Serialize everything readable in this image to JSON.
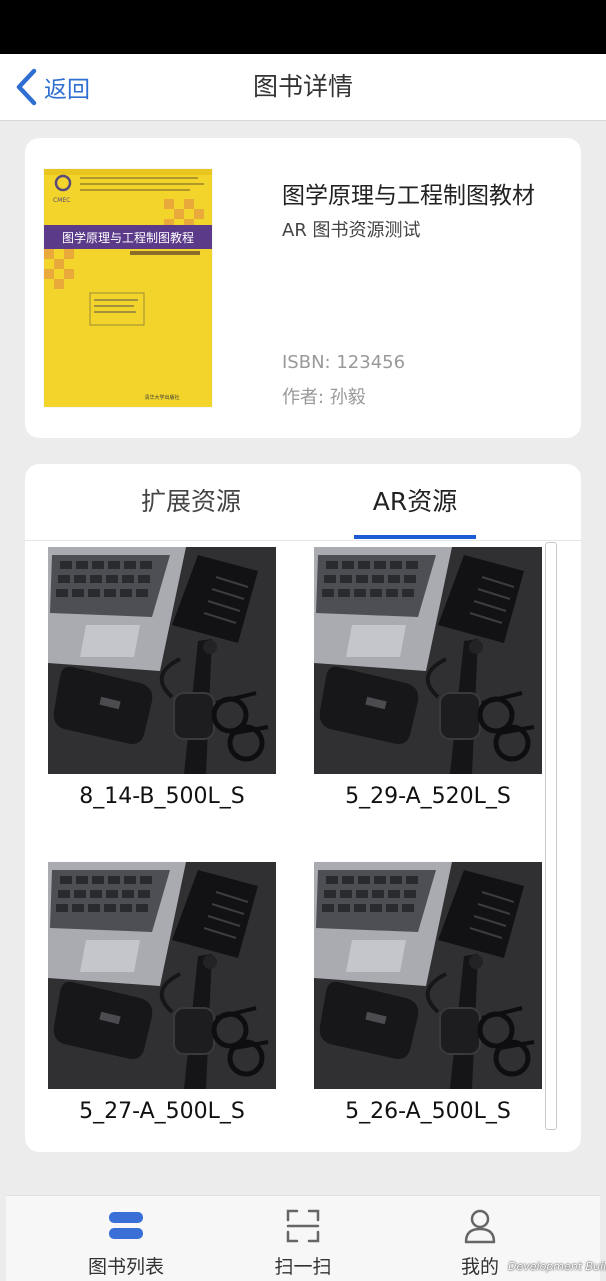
{
  "nav": {
    "back_label": "返回",
    "title": "图书详情"
  },
  "book": {
    "title": "图学原理与工程制图教材",
    "subtitle": "AR 图书资源测试",
    "isbn": "ISBN: 123456",
    "author": "作者: 孙毅",
    "cover_title": "图学原理与工程制图教程",
    "cover_logo": "CMEC",
    "cover_publisher": "清华大学出版社"
  },
  "tabs": [
    {
      "label": "扩展资源",
      "active": false
    },
    {
      "label": "AR资源",
      "active": true
    }
  ],
  "resources": [
    {
      "label": "8_14-B_500L_S"
    },
    {
      "label": "5_29-A_520L_S"
    },
    {
      "label": "5_27-A_500L_S"
    },
    {
      "label": "5_26-A_500L_S"
    }
  ],
  "bottom_tabs": [
    {
      "label": "图书列表",
      "icon": "book-list-icon"
    },
    {
      "label": "扫一扫",
      "icon": "scan-icon"
    },
    {
      "label": "我的",
      "icon": "user-icon"
    }
  ],
  "watermark": "Development Build",
  "colors": {
    "accent": "#1e5bd6",
    "back": "#2f6fd1",
    "active_tab_icon": "#3a6fd8"
  }
}
